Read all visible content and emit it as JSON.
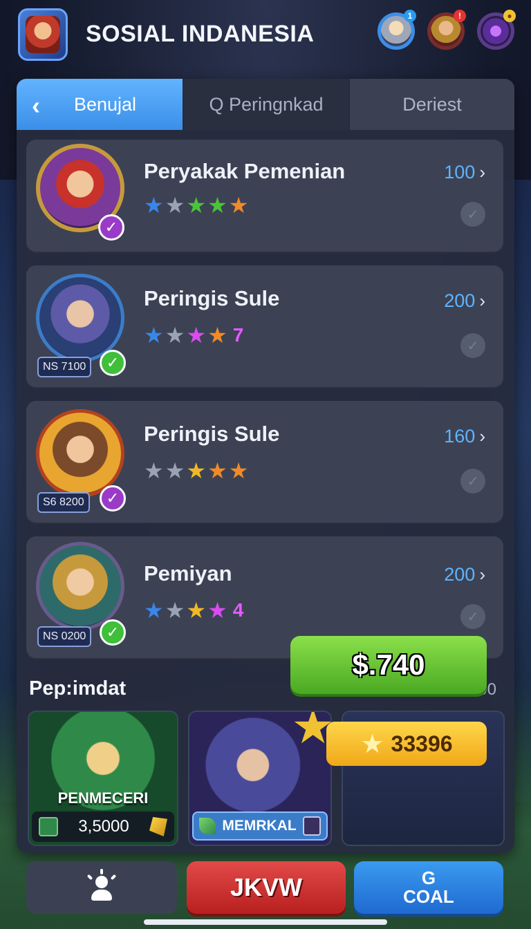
{
  "header": {
    "title": "SOSIAL INDANESIA",
    "badges": [
      {
        "icon": "character-avatar-icon",
        "notif": "1"
      },
      {
        "icon": "warrior-avatar-icon",
        "notif": "!"
      },
      {
        "icon": "portal-icon",
        "notif": "●"
      }
    ]
  },
  "tabs": [
    {
      "label": "Benujal",
      "icon": "back-chevron-icon",
      "active": true
    },
    {
      "label": "Q Peringnkad",
      "active": false
    },
    {
      "label": "Deriest",
      "active": false
    }
  ],
  "items": [
    {
      "name": "Peryakak Pemenian",
      "value": "100",
      "stars": [
        "blue",
        "grey",
        "green",
        "green",
        "orange"
      ],
      "star_count": "",
      "tag": "",
      "check": "purple"
    },
    {
      "name": "Peringis Sule",
      "value": "200",
      "stars": [
        "blue",
        "grey",
        "pink",
        "orange"
      ],
      "star_count": "7",
      "tag": "NS 7100",
      "check": "green"
    },
    {
      "name": "Peringis Sule",
      "value": "160",
      "stars": [
        "grey",
        "grey",
        "gold",
        "orange",
        "orange"
      ],
      "star_count": "",
      "tag": "S6 8200",
      "check": "purple"
    },
    {
      "name": "Pemiyan",
      "value": "200",
      "stars": [
        "blue",
        "grey",
        "gold",
        "pink"
      ],
      "star_count": "4",
      "tag": "NS 0200",
      "check": "green"
    }
  ],
  "section": {
    "title": "Pep:imdat",
    "meta": "ᵠs– 2.00"
  },
  "promos": {
    "p1": {
      "title": "PENMECERI",
      "price": "3,5000"
    },
    "p2": {
      "label": "MEMRKAL"
    },
    "buy": "$.740",
    "coins": "33396"
  },
  "bottom": {
    "red_label": "JKVW",
    "blue_label": "COAL",
    "blue_icon": "G"
  },
  "colors": {
    "accent": "#3a8fe8",
    "value": "#5db4ff",
    "buy": "#4aa822",
    "danger": "#b82020"
  }
}
